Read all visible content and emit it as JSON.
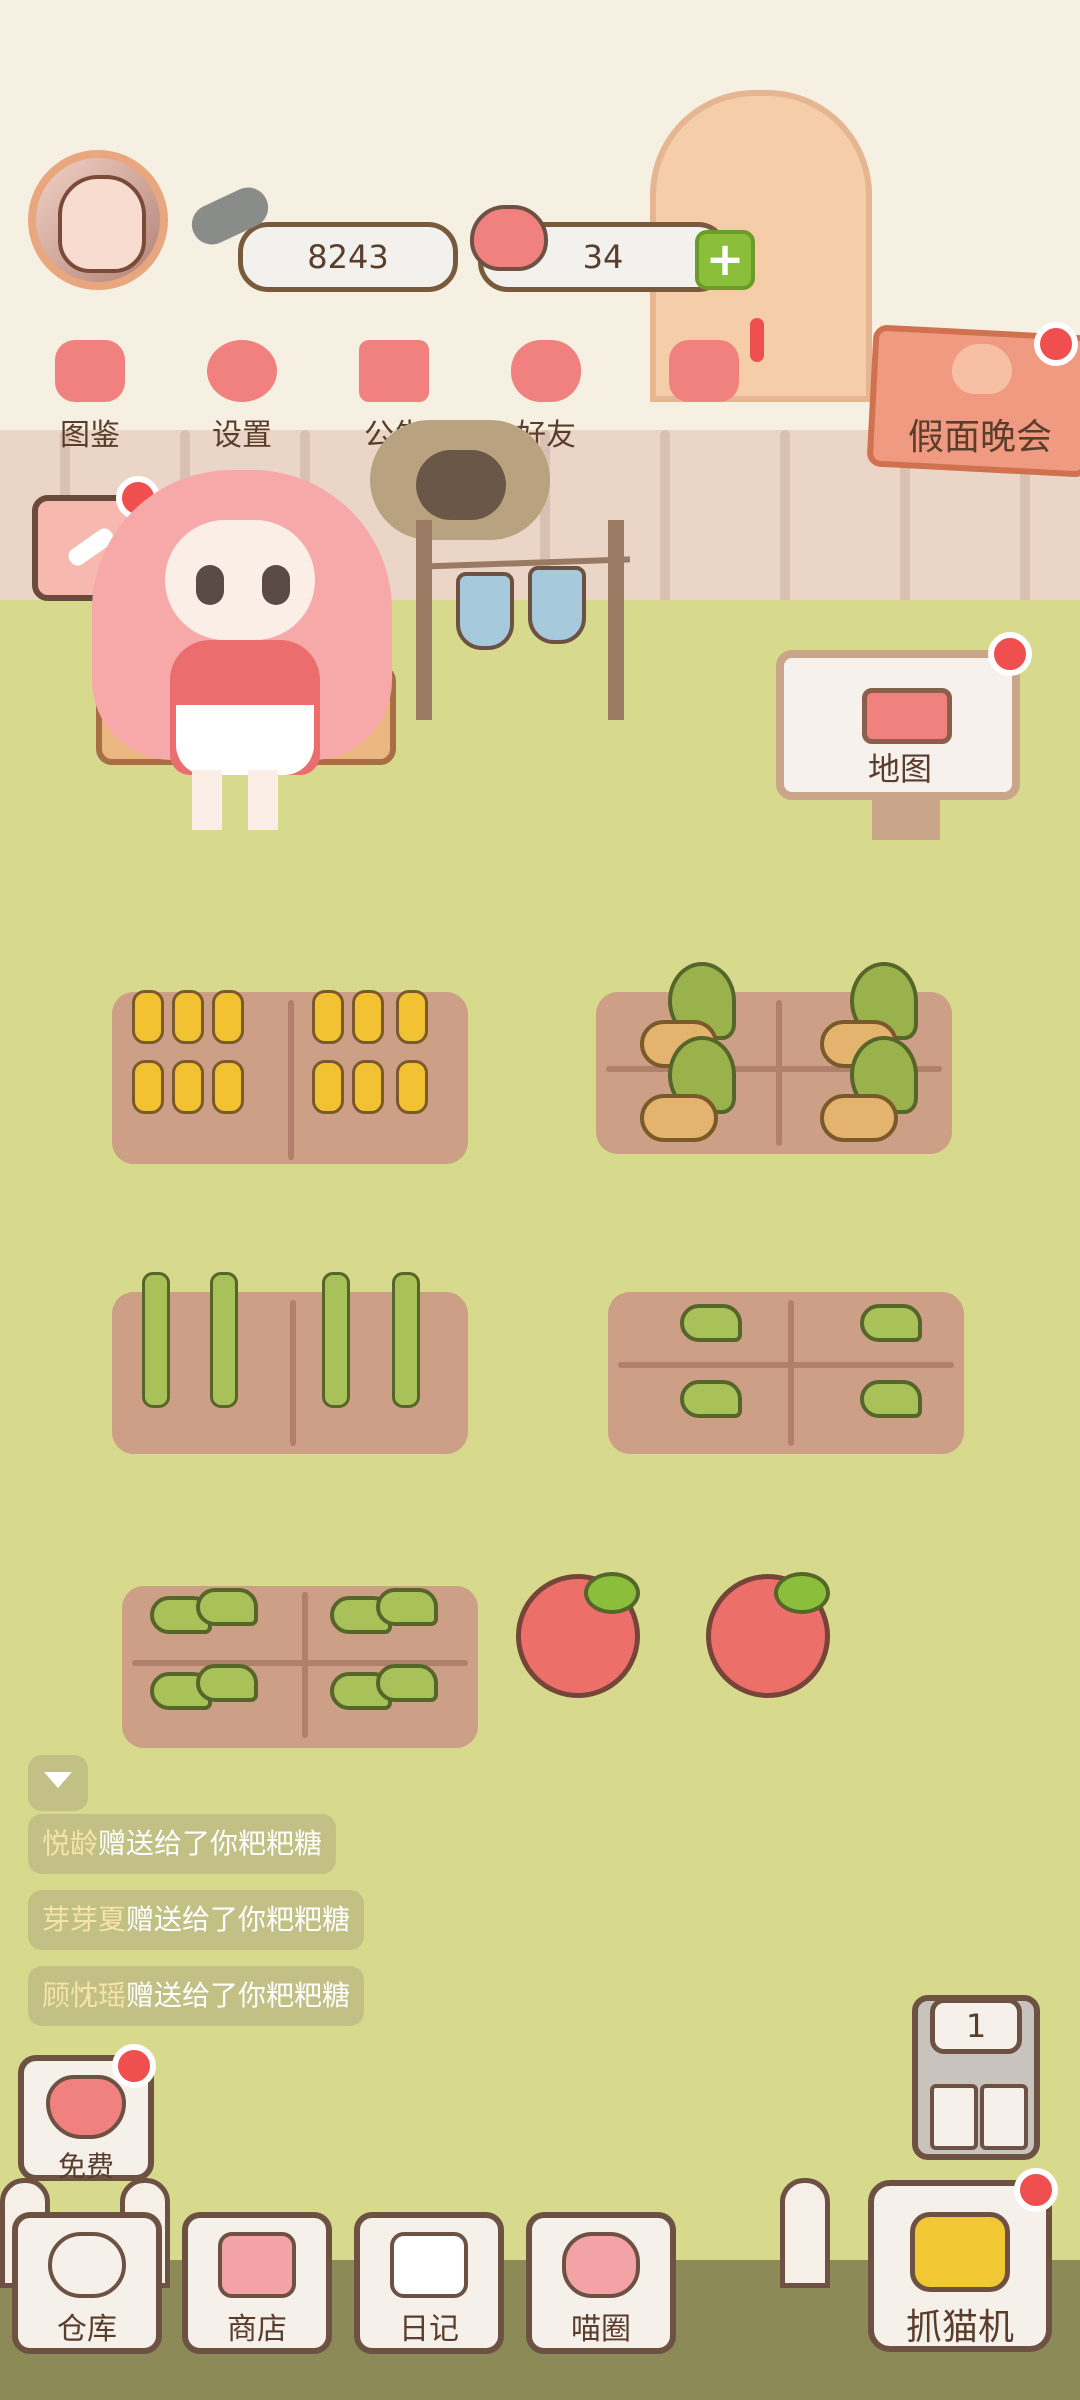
{
  "player": {
    "coins": "8243",
    "hearts": "34"
  },
  "menu": {
    "items": [
      {
        "label": "图鉴",
        "icon": "cat-head-icon"
      },
      {
        "label": "设置",
        "icon": "gear-icon"
      },
      {
        "label": "公告",
        "icon": "gift-icon"
      },
      {
        "label": "好友",
        "icon": "friends-icon"
      },
      {
        "label": "",
        "icon": "heart-mail-icon"
      }
    ]
  },
  "event": {
    "label": "假面晚会"
  },
  "map": {
    "label": "地图"
  },
  "feed": [
    {
      "name": "悦龄",
      "message": "赠送给了你粑粑糖"
    },
    {
      "name": "芽芽夏",
      "message": "赠送给了你粑粑糖"
    },
    {
      "name": "顾忱瑶",
      "message": "赠送给了你粑粑糖"
    }
  ],
  "free": {
    "label": "免费"
  },
  "claw_machine": {
    "label": "抓猫机",
    "count": "1"
  },
  "bottom_nav": [
    {
      "label": "仓库",
      "icon": "warehouse-icon"
    },
    {
      "label": "商店",
      "icon": "shop-icon"
    },
    {
      "label": "日记",
      "icon": "diary-icon"
    },
    {
      "label": "喵圈",
      "icon": "cat-planet-icon"
    }
  ],
  "colors": {
    "grass": "#d7d98c",
    "plot": "#cc9f86",
    "notify": "#ef4f4f",
    "accent_pink": "#f1817e"
  }
}
